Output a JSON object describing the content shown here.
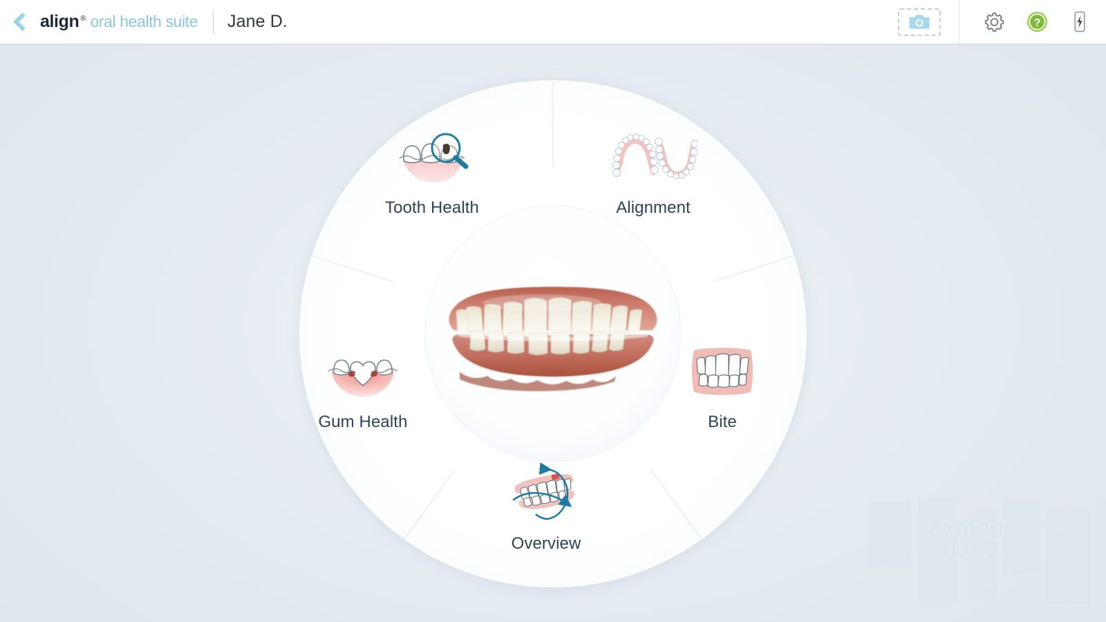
{
  "header": {
    "back_icon": "chevron-left-icon",
    "brand_name": "align",
    "brand_trademark": "®",
    "brand_suffix": "oral health suite",
    "patient_name": "Jane D.",
    "capture_icon": "camera-icon",
    "settings_icon": "gear-icon",
    "help_icon": "help-circle-icon",
    "scanner_icon": "scanner-wand-icon",
    "brand_color": "#1d2a33",
    "brand_suffix_color": "#8fc6d9",
    "accent_color": "#9ed2ea",
    "help_color": "#8cc63f"
  },
  "wheel": {
    "center_scan_name": "intraoral-scan-3d-model",
    "segments": [
      {
        "id": "tooth-health",
        "label": "Tooth Health",
        "icon": "tooth-magnifier-icon"
      },
      {
        "id": "alignment",
        "label": "Alignment",
        "icon": "dental-arches-icon"
      },
      {
        "id": "bite",
        "label": "Bite",
        "icon": "front-teeth-bite-icon"
      },
      {
        "id": "overview",
        "label": "Overview",
        "icon": "rotating-teeth-icon"
      },
      {
        "id": "gum-health",
        "label": "Gum Health",
        "icon": "heart-tooth-gums-icon"
      }
    ],
    "label_color": "#2c4459",
    "wheel_fill": "#ffffff",
    "background_color": "#e4ebf1"
  },
  "watermark": {
    "line1": "exmoor",
    "line2": "news"
  }
}
